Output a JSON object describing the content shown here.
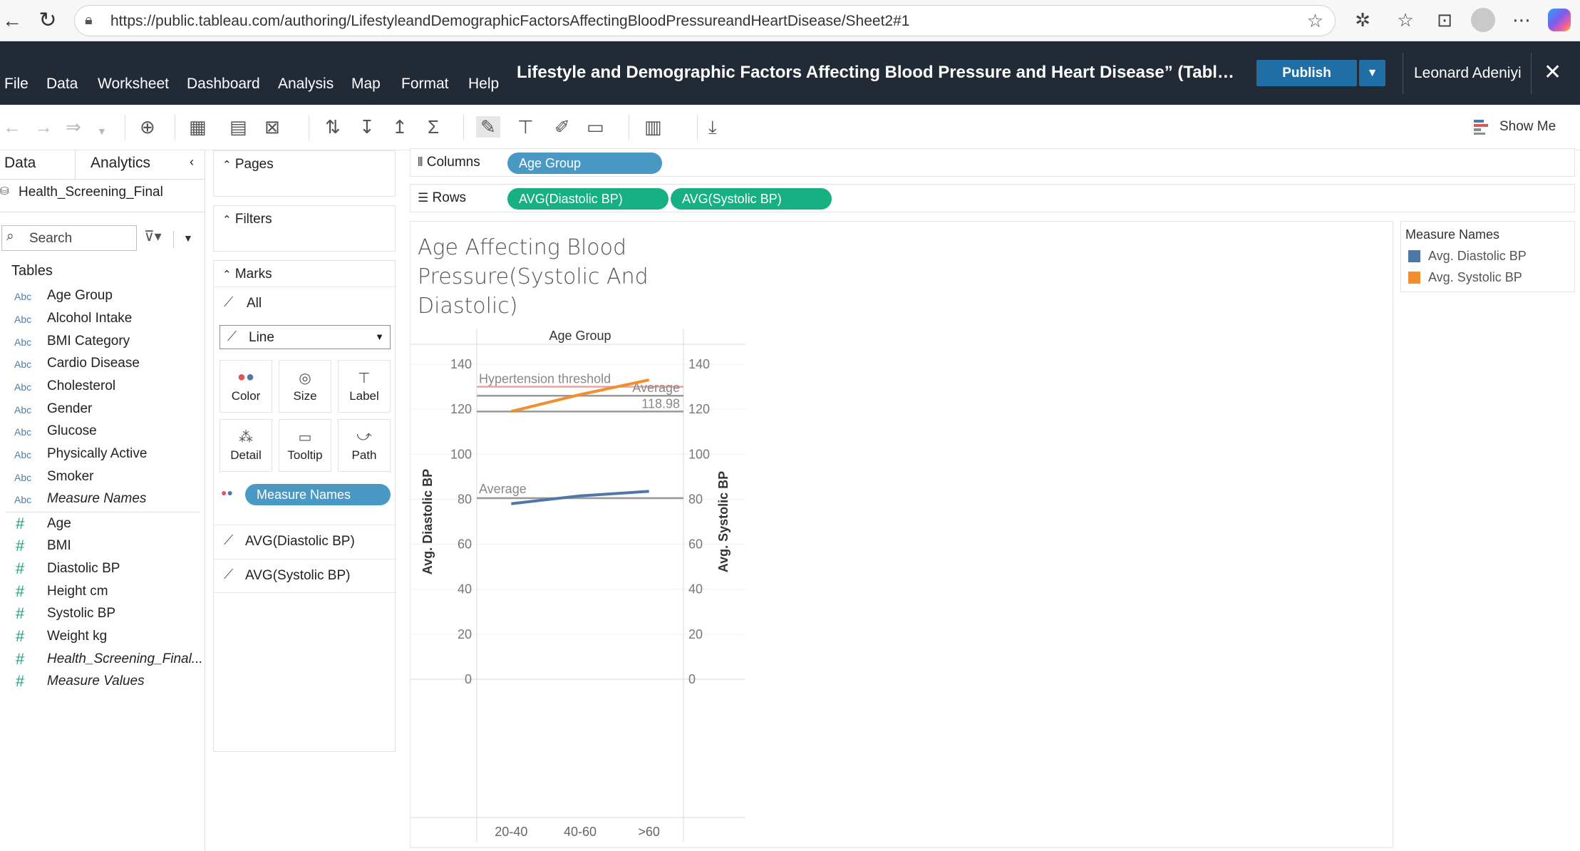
{
  "browser": {
    "url": "https://public.tableau.com/authoring/LifestyleandDemographicFactorsAffectingBloodPressureandHeartDisease/Sheet2#1"
  },
  "app": {
    "menu": [
      "File",
      "Data",
      "Worksheet",
      "Dashboard",
      "Analysis",
      "Map",
      "Format",
      "Help"
    ],
    "workbook_title": "Lifestyle and Demographic Factors Affecting Blood Pressure and Heart Disease” (Tabl…",
    "publish_label": "Publish",
    "user": "Leonard Adeniyi",
    "show_me": "Show Me"
  },
  "data_pane": {
    "tab_data": "Data",
    "tab_analytics": "Analytics",
    "datasource": "Health_Screening_Final",
    "search_placeholder": "Search",
    "tables_label": "Tables",
    "dimensions": [
      {
        "type": "Abc",
        "name": "Age Group"
      },
      {
        "type": "Abc",
        "name": "Alcohol Intake"
      },
      {
        "type": "Abc",
        "name": "BMI Category"
      },
      {
        "type": "Abc",
        "name": "Cardio Disease"
      },
      {
        "type": "Abc",
        "name": "Cholesterol"
      },
      {
        "type": "Abc",
        "name": "Gender"
      },
      {
        "type": "Abc",
        "name": "Glucose"
      },
      {
        "type": "Abc",
        "name": "Physically Active"
      },
      {
        "type": "Abc",
        "name": "Smoker"
      },
      {
        "type": "Abc",
        "name": "Measure Names"
      }
    ],
    "measures": [
      {
        "type": "#",
        "name": "Age"
      },
      {
        "type": "#",
        "name": "BMI"
      },
      {
        "type": "#",
        "name": "Diastolic BP"
      },
      {
        "type": "#",
        "name": "Height cm"
      },
      {
        "type": "#",
        "name": "Systolic BP"
      },
      {
        "type": "#",
        "name": "Weight kg"
      },
      {
        "type": "#",
        "name": "Health_Screening_Final..."
      },
      {
        "type": "#",
        "name": "Measure Values"
      }
    ]
  },
  "cards": {
    "pages": "Pages",
    "filters": "Filters",
    "marks": "Marks",
    "all": "All",
    "mark_type": "Line",
    "buttons": [
      "Color",
      "Size",
      "Label",
      "Detail",
      "Tooltip",
      "Path"
    ],
    "color_pill": "Measure Names",
    "layer1": "AVG(Diastolic BP)",
    "layer2": "AVG(Systolic BP)"
  },
  "shelves": {
    "columns_label": "Columns",
    "rows_label": "Rows",
    "columns_pill": "Age Group",
    "rows_pills": [
      "AVG(Diastolic BP)",
      "AVG(Systolic BP)"
    ]
  },
  "legend": {
    "title": "Measure Names",
    "items": [
      {
        "name": "Avg. Diastolic BP",
        "color": "#4e79a7"
      },
      {
        "name": "Avg. Systolic BP",
        "color": "#f28e2b"
      }
    ]
  },
  "chart_data": {
    "type": "line",
    "title": "Age Affecting Blood Pressure(Systolic And Diastolic)",
    "column_header": "Age Group",
    "categories": [
      "20-40",
      "40-60",
      ">60"
    ],
    "series": [
      {
        "name": "Avg. Diastolic BP",
        "axis": "left",
        "color": "#4e79a7",
        "values": [
          78,
          81.5,
          83.5
        ]
      },
      {
        "name": "Avg. Systolic BP",
        "axis": "right",
        "color": "#f28e2b",
        "values": [
          119,
          126.5,
          133
        ]
      }
    ],
    "ylabel_left": "Avg. Diastolic BP",
    "ylabel_right": "Avg. Systolic BP",
    "ylim": [
      0,
      140
    ],
    "yticks": [
      0,
      20,
      40,
      60,
      80,
      100,
      120,
      140
    ],
    "reference_lines": [
      {
        "label": "Hypertension threshold",
        "value": 130,
        "color": "#f0a0a0"
      },
      {
        "label": "Average",
        "value": 126,
        "color": "#999999"
      },
      {
        "label": "118.98",
        "value": 118.98,
        "color": "#999999"
      },
      {
        "label": "Average",
        "value": 80.5,
        "color": "#999999"
      }
    ]
  }
}
